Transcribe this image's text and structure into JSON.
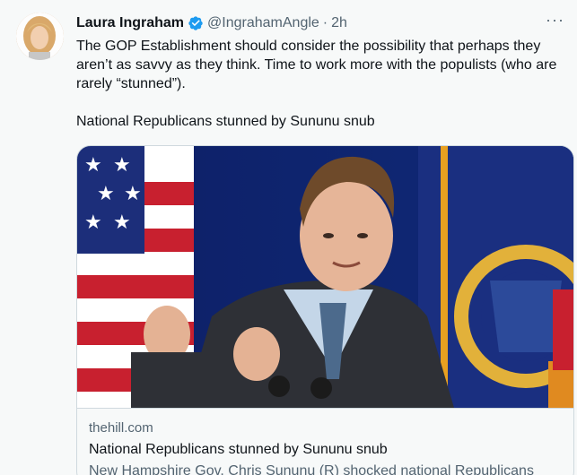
{
  "tweet": {
    "author_name": "Laura Ingraham",
    "handle": "@IngrahamAngle",
    "separator": "·",
    "time": "2h",
    "more_label": "···",
    "text": "The GOP Establishment should consider the possibility that perhaps they aren’t as savvy as they think. Time to work more with the populists (who are rarely “stunned”).\n\nNational Republicans stunned by Sununu snub"
  },
  "card": {
    "domain": "thehill.com",
    "title": "National Republicans stunned by Sununu snub",
    "description": "New Hampshire Gov. Chris Sununu (R) shocked national Republicans"
  },
  "colors": {
    "verified_blue": "#1d9bf0",
    "background": "#f7f9f9",
    "text": "#0f1419",
    "secondary": "#536471",
    "border": "#cfd9de"
  },
  "icons": {
    "verified": "verified-badge-icon",
    "more": "more-horizontal-icon"
  }
}
